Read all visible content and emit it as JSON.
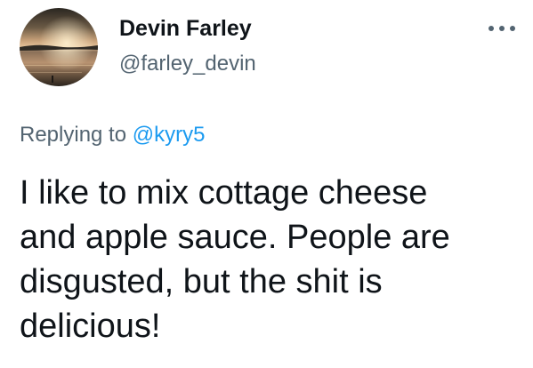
{
  "author": {
    "display_name": "Devin Farley",
    "handle": "@farley_devin",
    "avatar_icon": "sunset-lake-avatar"
  },
  "more_icon": "more-dots-icon",
  "reply": {
    "prefix": "Replying to",
    "mention": "@kyry5"
  },
  "tweet": {
    "lines": [
      "I like to mix cottage cheese",
      "and apple sauce. People are",
      "disgusted, but the shit is",
      "delicious!"
    ]
  },
  "colors": {
    "text": "#0f1419",
    "secondary": "#536471",
    "link": "#1d9bf0"
  }
}
